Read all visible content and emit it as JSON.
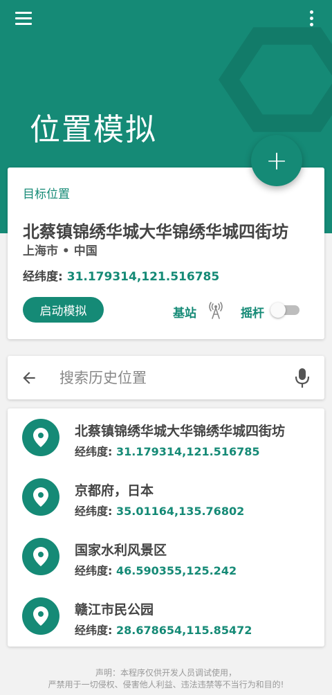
{
  "header": {
    "title": "位置模拟",
    "menu_icon": "hamburger-menu-icon",
    "more_icon": "more-vert-icon",
    "color": "#158a76"
  },
  "fab": {
    "label": "+",
    "icon": "add-icon"
  },
  "target": {
    "label": "目标位置",
    "name": "北蔡镇锦绣华城大华锦绣华城四街坊",
    "region": "上海市  •  中国",
    "coord_label": "经纬度:",
    "coord_value": "31.179314,121.516785",
    "start_button": "启动模拟",
    "station_label": "基站",
    "station_icon": "cell-tower-icon",
    "joystick_label": "摇杆",
    "joystick_enabled": false
  },
  "search": {
    "placeholder": "搜索历史位置",
    "value": "",
    "back_icon": "arrow-back-icon",
    "mic_icon": "microphone-icon"
  },
  "history": [
    {
      "name": "北蔡镇锦绣华城大华锦绣华城四街坊",
      "coord_label": "经纬度:",
      "coord_value": "31.179314,121.516785"
    },
    {
      "name": "京都府，日本",
      "coord_label": "经纬度:",
      "coord_value": "35.01164,135.76802"
    },
    {
      "name": "国家水利风景区",
      "coord_label": "经纬度:",
      "coord_value": "46.590355,125.242"
    },
    {
      "name": "赣江市民公园",
      "coord_label": "经纬度:",
      "coord_value": "28.678654,115.85472"
    }
  ],
  "disclaimer": {
    "line1": "声明：本程序仅供开发人员调试使用，",
    "line2": "严禁用于一切侵权、侵害他人利益、违法违禁等不当行为和目的!"
  }
}
